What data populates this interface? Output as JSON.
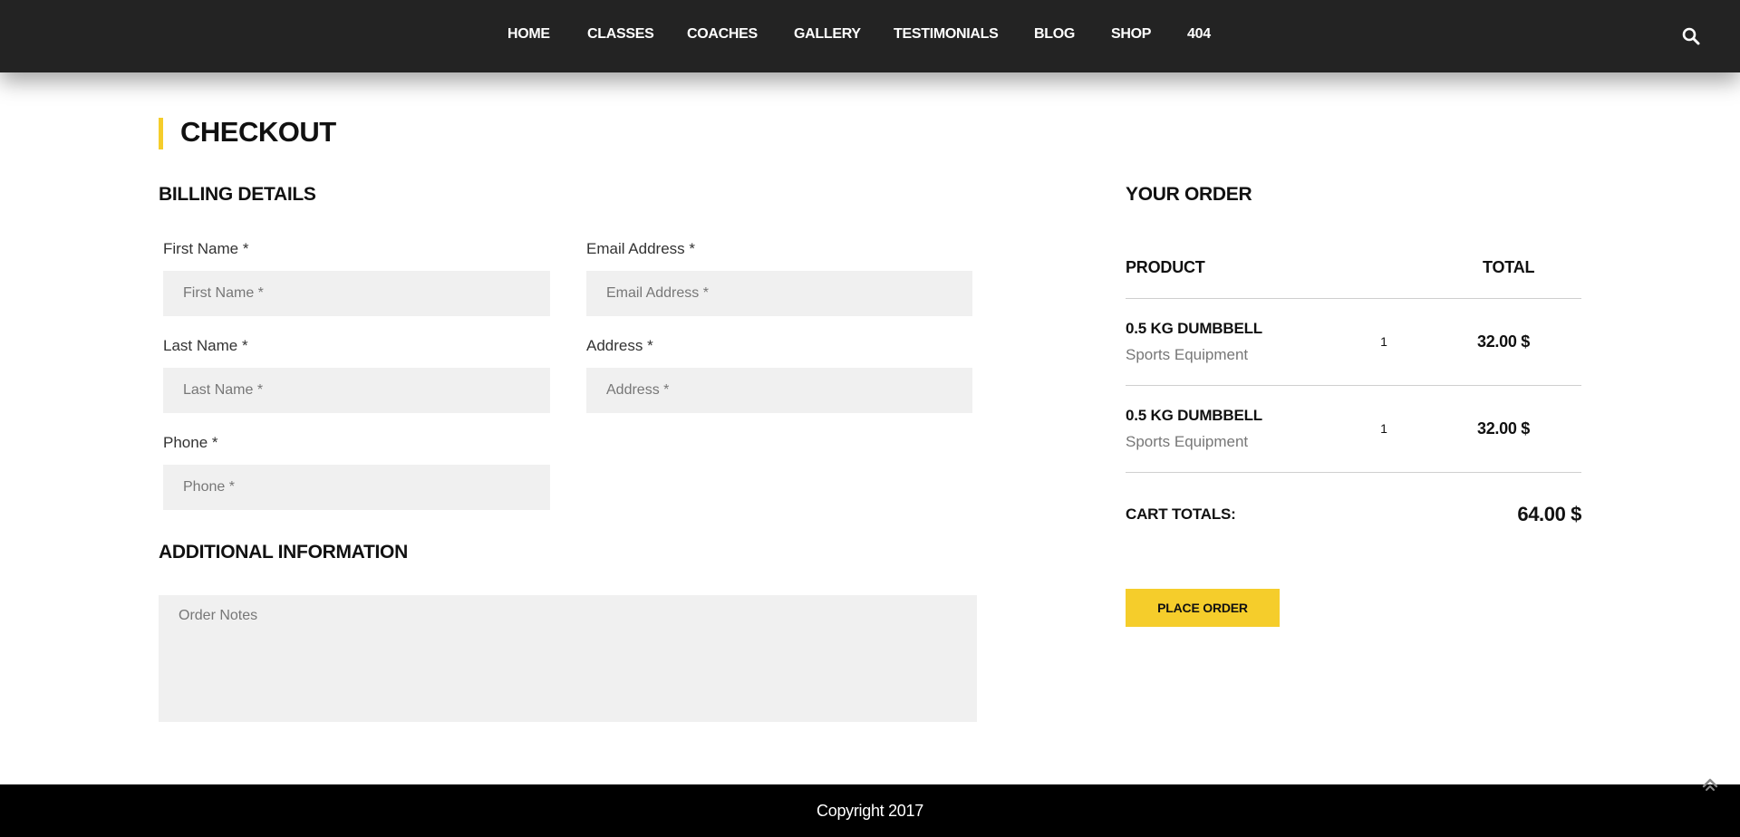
{
  "nav": {
    "items": [
      {
        "label": "HOME"
      },
      {
        "label": "CLASSES"
      },
      {
        "label": "COACHES"
      },
      {
        "label": "GALLERY"
      },
      {
        "label": "TESTIMONIALS"
      },
      {
        "label": "BLOG"
      },
      {
        "label": "SHOP"
      },
      {
        "label": "404"
      }
    ],
    "search_icon": "search-icon"
  },
  "page": {
    "title": "CHECKOUT",
    "accent_color": "#f5cd2b"
  },
  "billing": {
    "title": "BILLING DETAILS",
    "fields": {
      "first_name": {
        "label": "First Name",
        "required": "*",
        "placeholder": "First Name *",
        "value": ""
      },
      "email": {
        "label": "Email Address",
        "required": "*",
        "placeholder": "Email Address *",
        "value": ""
      },
      "last_name": {
        "label": "Last Name",
        "required": "*",
        "placeholder": "Last Name *",
        "value": ""
      },
      "address": {
        "label": "Address",
        "required": "*",
        "placeholder": "Address *",
        "value": ""
      },
      "phone": {
        "label": "Phone",
        "required": "*",
        "placeholder": "Phone *",
        "value": ""
      }
    }
  },
  "additional": {
    "title": "ADDITIONAL INFORMATION",
    "notes_placeholder": "Order Notes",
    "notes_value": ""
  },
  "order": {
    "title": "YOUR ORDER",
    "col_product": "PRODUCT",
    "col_total": "TOTAL",
    "items": [
      {
        "name": "0.5 KG DUMBBELL",
        "category": "Sports Equipment",
        "qty": "1",
        "total": "32.00 $"
      },
      {
        "name": "0.5 KG DUMBBELL",
        "category": "Sports Equipment",
        "qty": "1",
        "total": "32.00 $"
      }
    ],
    "cart_totals_label": "CART TOTALS:",
    "cart_totals_value": "64.00 $",
    "place_order_label": "PLACE ORDER"
  },
  "footer": {
    "copyright": "Copyright 2017",
    "scroll_top_icon": "chevron-up-icon"
  }
}
